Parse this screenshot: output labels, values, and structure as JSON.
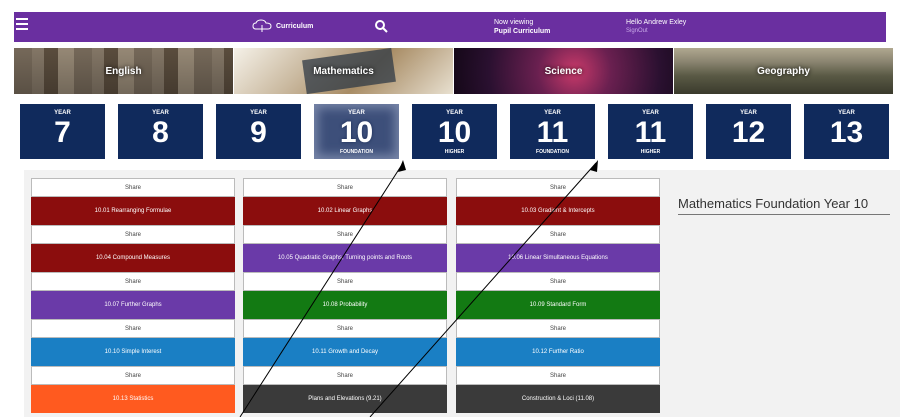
{
  "header": {
    "brand": "Curriculum",
    "viewing_label": "Now viewing",
    "viewing_value": "Pupil Curriculum",
    "greeting": "Hello Andrew Exley",
    "signout": "SignOut"
  },
  "subjects": [
    "English",
    "Mathematics",
    "Science",
    "Geography"
  ],
  "years": [
    {
      "label": "YEAR",
      "number": "7",
      "sub": ""
    },
    {
      "label": "YEAR",
      "number": "8",
      "sub": ""
    },
    {
      "label": "YEAR",
      "number": "9",
      "sub": ""
    },
    {
      "label": "YEAR",
      "number": "10",
      "sub": "FOUNDATION"
    },
    {
      "label": "YEAR",
      "number": "10",
      "sub": "HIGHER"
    },
    {
      "label": "YEAR",
      "number": "11",
      "sub": "FOUNDATION"
    },
    {
      "label": "YEAR",
      "number": "11",
      "sub": "HIGHER"
    },
    {
      "label": "YEAR",
      "number": "12",
      "sub": ""
    },
    {
      "label": "YEAR",
      "number": "13",
      "sub": ""
    }
  ],
  "share_label": "Share",
  "columns": [
    [
      {
        "title": "10.01 Rearranging Formulae",
        "color": "#8b0d0d"
      },
      {
        "title": "10.04 Compound Measures",
        "color": "#8b0d0d"
      },
      {
        "title": "10.07 Further Graphs",
        "color": "#6a3aa8"
      },
      {
        "title": "10.10 Simple Interest",
        "color": "#1a7fc4"
      },
      {
        "title": "10.13 Statistics",
        "color": "#ff5a1f"
      }
    ],
    [
      {
        "title": "10.02 Linear Graphs",
        "color": "#8b0d0d"
      },
      {
        "title": "10.05 Quadratic Graphs, Turning points and Roots",
        "color": "#6a3aa8"
      },
      {
        "title": "10.08 Probability",
        "color": "#137a13"
      },
      {
        "title": "10.11 Growth and Decay",
        "color": "#1a7fc4"
      },
      {
        "title": "Plans and Elevations (9.21)",
        "color": "#3a3a3a"
      }
    ],
    [
      {
        "title": "10.03 Gradient & Intercepts",
        "color": "#8b0d0d"
      },
      {
        "title": "10.06 Linear Simultaneous Equations",
        "color": "#6a3aa8"
      },
      {
        "title": "10.09 Standard Form",
        "color": "#137a13"
      },
      {
        "title": "10.12 Further Ratio",
        "color": "#1a7fc4"
      },
      {
        "title": "Construction & Loci (11.08)",
        "color": "#3a3a3a"
      }
    ]
  ],
  "panel_title": "Mathematics Foundation Year 10",
  "colors": {
    "header": "#6a2fa0",
    "year_tile": "#102a5c"
  }
}
